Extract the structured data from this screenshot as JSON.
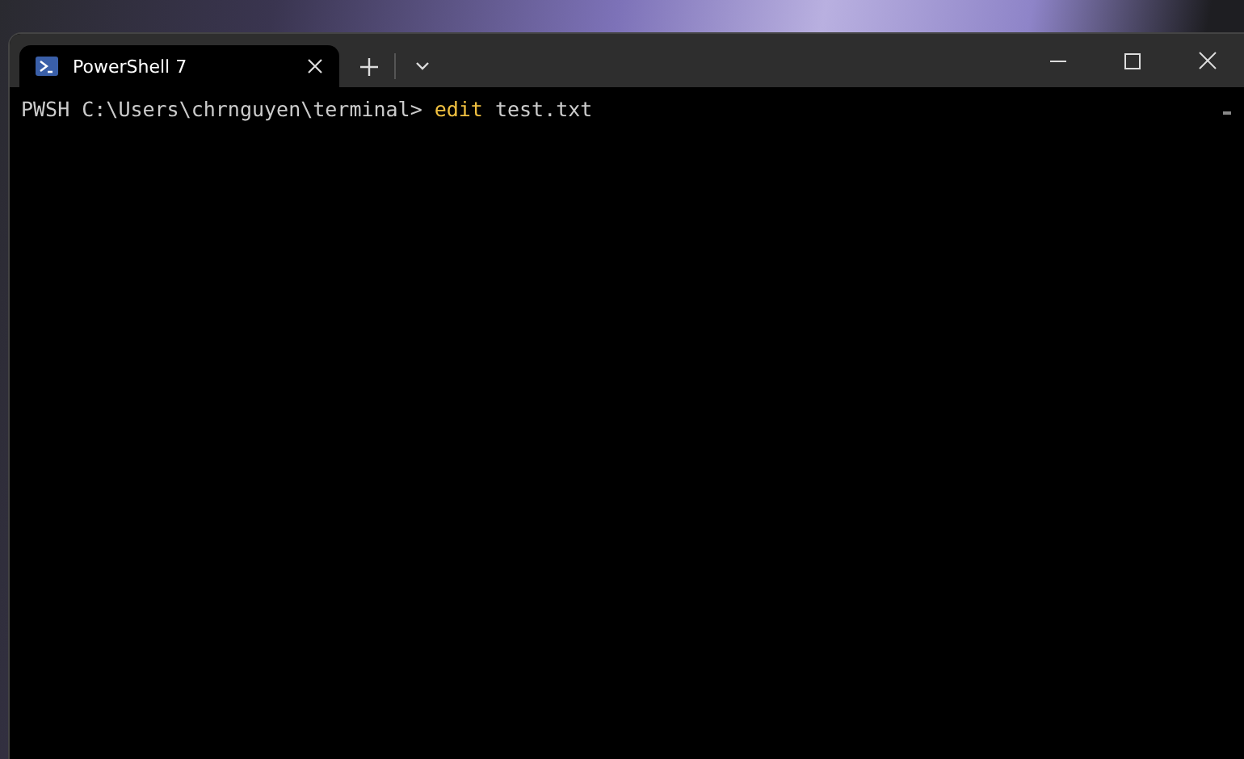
{
  "tabs": [
    {
      "title": "PowerShell 7",
      "selected": true
    }
  ],
  "terminal": {
    "lines": [
      {
        "prompt": "PWSH C:\\Users\\chrnguyen\\terminal>",
        "command": "edit",
        "args": "test.txt"
      }
    ]
  }
}
